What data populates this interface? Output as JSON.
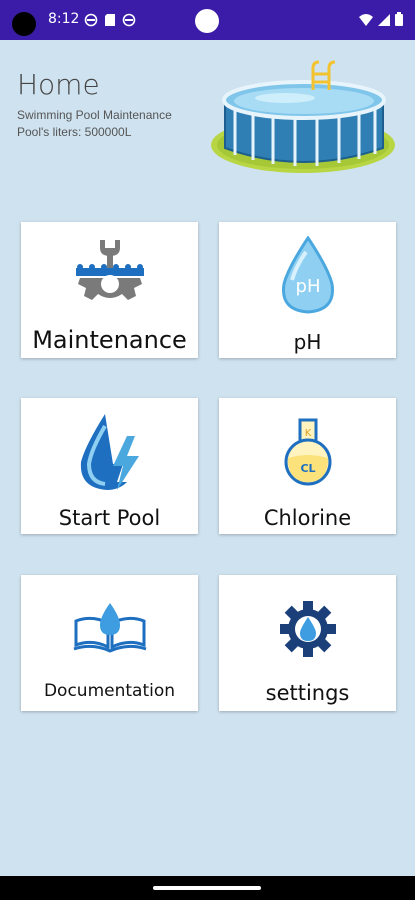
{
  "status_bar": {
    "time": "8:12",
    "left_icons": [
      "vpn-icon",
      "sd-card-icon",
      "vpn-icon"
    ],
    "right_icons": [
      "wifi-icon",
      "signal-icon",
      "battery-icon"
    ],
    "background": "#3a1ca8"
  },
  "header": {
    "title": "Home",
    "subtitle": "Swimming Pool Maintenance",
    "liters_text": "Pool's liters: 500000L"
  },
  "cards": [
    {
      "label": "Maintenance",
      "icon": "wrench-gear-icon"
    },
    {
      "label": "pH",
      "icon": "ph-drop-icon"
    },
    {
      "label": "Start Pool",
      "icon": "water-lightning-icon"
    },
    {
      "label": "Chlorine",
      "icon": "chlorine-flask-icon"
    },
    {
      "label": "Documentation",
      "icon": "book-drop-icon"
    },
    {
      "label": "settings",
      "icon": "gear-drop-icon"
    }
  ],
  "colors": {
    "background": "#cfe2ef",
    "accent_blue": "#1e6fc0",
    "card": "#ffffff"
  }
}
